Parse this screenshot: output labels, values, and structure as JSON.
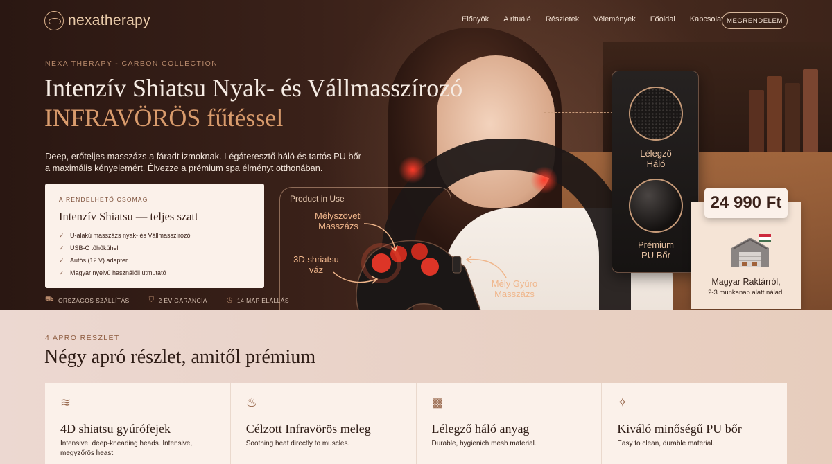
{
  "brand": {
    "name": "nexatherapy"
  },
  "nav": {
    "items": [
      "Előnyök",
      "A rituálé",
      "Részletek",
      "Vélemények",
      "Főoldal",
      "Kapcsolat"
    ],
    "cta": "MEGRENDELEM"
  },
  "hero": {
    "eyebrow": "NEXA THERAPY - CARBON COLLECTION",
    "title_line1": "Intenzív Shiatsu Nyak- és Vállmasszírozó",
    "title_line2": "INFRAVÖRÖS fűtéssel",
    "lead": "Deep, erőteljes masszázs a fáradt izmoknak. Légáteresztő háló és tartós PU bőr a maximális kényelemért. Élvezze a prémium spa élményt otthonában."
  },
  "package": {
    "eyebrow": "A RENDELHETŐ CSOMAG",
    "title": "Intenzív Shiatsu — teljes szatt",
    "items": [
      "U-alakú masszázs nyak- és Vállmasszírozó",
      "USB-C tőhőkühel",
      "Autós (12 V) adapter",
      "Magyar nyelvű használóli útmutató"
    ]
  },
  "trust": [
    {
      "icon": "truck-icon",
      "label": "ORSZÁGOS SZÁLLÍTÁS"
    },
    {
      "icon": "shield-icon",
      "label": "2 ÉV GARANCIA"
    },
    {
      "icon": "timer-icon",
      "label": "14 MAP ELÁLLÁS"
    }
  ],
  "product": {
    "label": "Product in Use",
    "callouts": [
      "Mélyszöveti Masszázs",
      "3D shriatsu váz",
      "Mély Gyúro Masszázs"
    ]
  },
  "materials": {
    "mesh": "Lélegző Háló",
    "leather": "Prémium PU Bőr"
  },
  "price": "24 990 Ft",
  "warehouse": {
    "title": "Magyar Raktárról,",
    "subtitle": "2-3 munkanap alatt nálad."
  },
  "details": {
    "eyebrow": "4 APRÓ RÉSZLET",
    "title": "Négy apró részlet, amitől prémium",
    "cards": [
      {
        "icon": "waves-icon",
        "title": "4D shiatsu gyúrófejek",
        "desc": "Intensive, deep-kneading heads. Intensive, megyzőrös heast."
      },
      {
        "icon": "flame-icon",
        "title": "Célzott Infravörös meleg",
        "desc": "Soothing heat directly to muscles."
      },
      {
        "icon": "mesh-icon",
        "title": "Lélegző háló anyag",
        "desc": "Durable, hygienich mesh material."
      },
      {
        "icon": "leather-icon",
        "title": "Kiváló minőségű PU bőr",
        "desc": "Easy to clean, durable material."
      }
    ]
  },
  "colors": {
    "accent": "#d99b6c",
    "dark": "#2a1712",
    "cream": "#fbf1ea"
  }
}
